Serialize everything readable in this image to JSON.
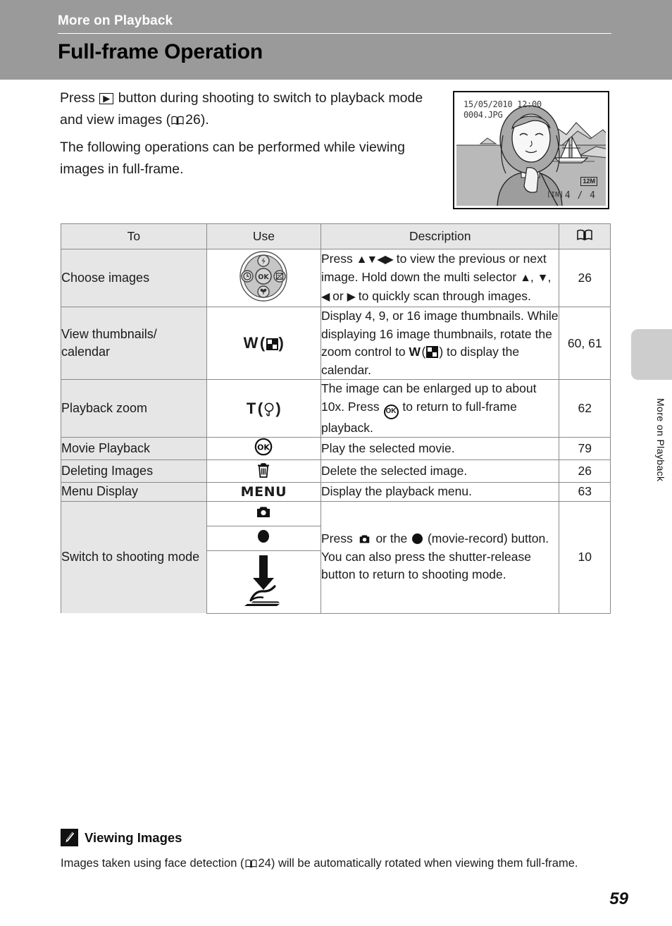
{
  "header": {
    "chapter": "More on Playback",
    "title": "Full-frame Operation"
  },
  "side_tab": {
    "label": "More on Playback",
    "color": "#cdcdcd"
  },
  "intro": {
    "line1_a": "Press",
    "line1_b": "button during shooting to switch to playback mode and view images (",
    "line1_ref": "26",
    "line1_c": ").",
    "para2": "The following operations can be performed while viewing images in full-frame."
  },
  "lcd": {
    "datetime": "15/05/2010 12:00",
    "filename": "0004.JPG",
    "frame_counter": "4 / 4",
    "internal_memory": "IN",
    "image_size": "12M"
  },
  "table": {
    "headers": {
      "to": "To",
      "use": "Use",
      "description": "Description",
      "reference": "book-icon"
    },
    "rows": [
      {
        "to": "Choose images",
        "use_icon": "multi-selector-dial",
        "desc_a": "Press",
        "desc_b": "to view the previous or next image. Hold down the multi selector",
        "desc_c": ",",
        "desc_d": ",",
        "desc_e": "or",
        "desc_f": "to quickly scan through images.",
        "ref": "26"
      },
      {
        "to": "View thumbnails/ calendar",
        "use_label": "W",
        "use_icon": "thumbnail-grid-icon",
        "desc_a": "Display 4, 9, or 16 image thumbnails. While displaying 16 image thumbnails, rotate the zoom control to",
        "desc_w": "W",
        "desc_b": ") to display the calendar.",
        "ref": "60, 61"
      },
      {
        "to": "Playback zoom",
        "use_label": "T",
        "use_icon": "magnifier-icon",
        "desc_a": "The image can be enlarged up to about 10x. Press",
        "desc_ok": "OK",
        "desc_b": "to return to full-frame playback.",
        "ref": "62"
      },
      {
        "to": "Movie Playback",
        "use_icon": "ok-button-icon",
        "desc": "Play the selected movie.",
        "ref": "79"
      },
      {
        "to": "Deleting Images",
        "use_icon": "trash-icon",
        "desc": "Delete the selected image.",
        "ref": "26"
      },
      {
        "to": "Menu Display",
        "use_label": "MENU",
        "desc": "Display the playback menu.",
        "ref": "63"
      },
      {
        "to": "Switch to shooting mode",
        "use_icons": [
          "camera-shooting-mode-icon",
          "movie-record-button-icon",
          "shutter-release-press-icon"
        ],
        "desc_a": "Press",
        "desc_b": "or the",
        "desc_c": "(movie-record) button. You can also press the shutter-release button to return to shooting mode.",
        "ref": "10"
      }
    ]
  },
  "note": {
    "icon": "pencil-note-icon",
    "title": "Viewing Images",
    "body_a": "Images taken using face detection (",
    "body_ref": "24",
    "body_b": ") will be automatically rotated when viewing them full-frame."
  },
  "page_number": "59"
}
